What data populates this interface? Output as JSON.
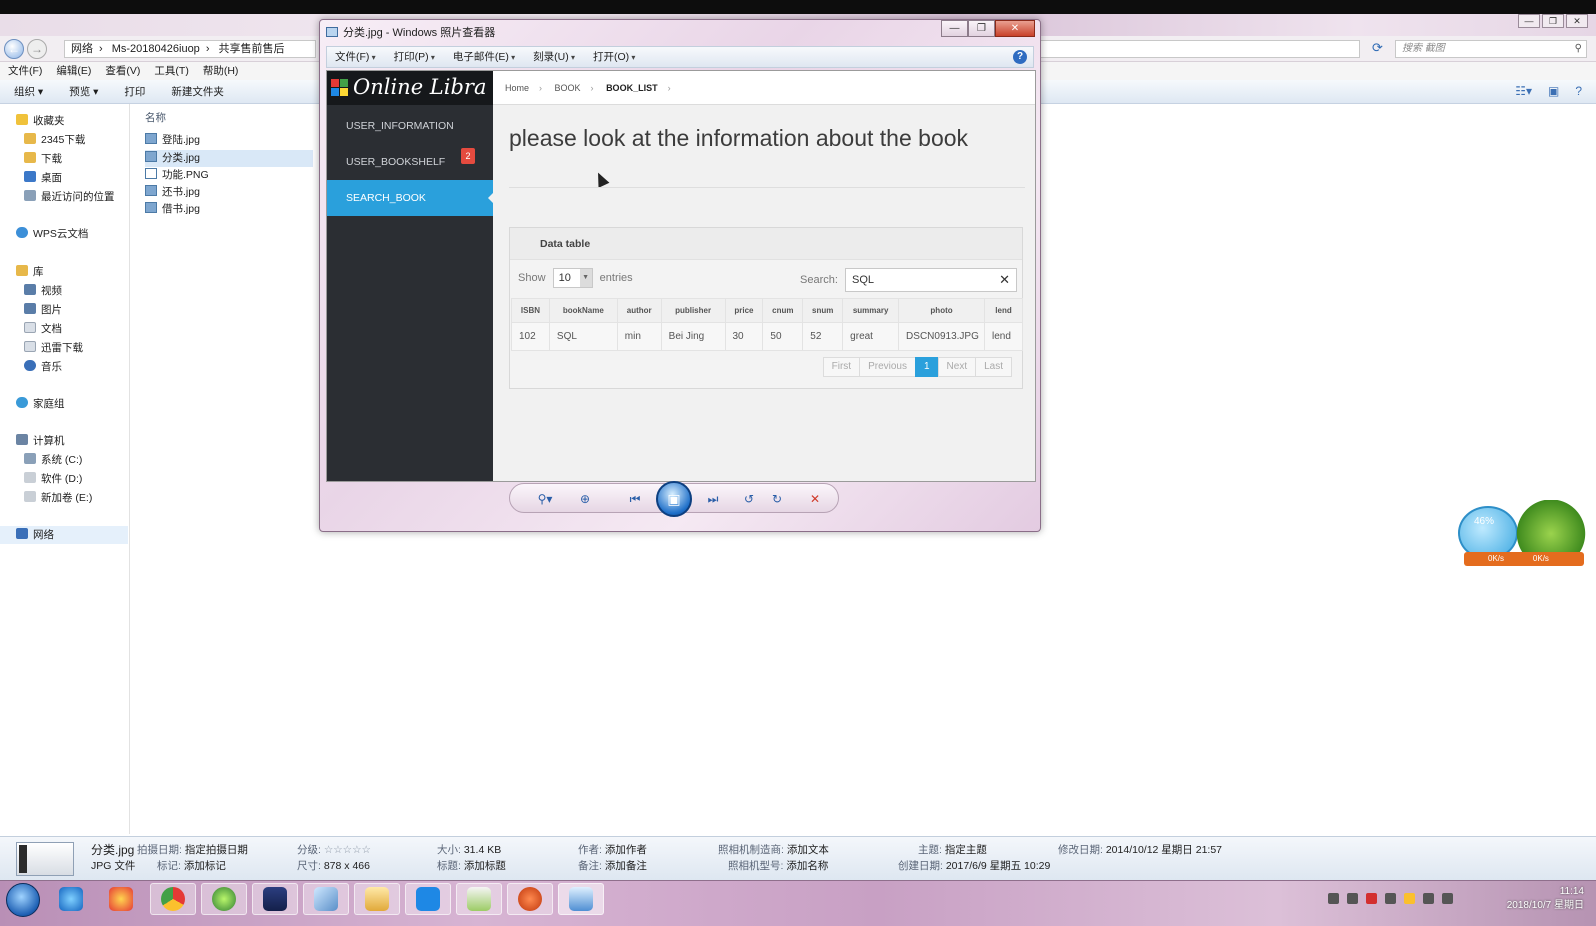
{
  "explorer": {
    "breadcrumb": [
      "网络",
      "Ms-20180426iuop",
      "共享售前售后"
    ],
    "search_placeholder": "搜索 截图",
    "menu": [
      "文件(F)",
      "编辑(E)",
      "查看(V)",
      "工具(T)",
      "帮助(H)"
    ],
    "commands": [
      "组织 ▾",
      "预览 ▾",
      "打印",
      "新建文件夹"
    ],
    "nav": [
      {
        "label": "收藏夹",
        "color": "#f0c23b"
      },
      {
        "label": "2345下载",
        "color": "#e7b84a"
      },
      {
        "label": "下载",
        "color": "#e7b84a"
      },
      {
        "label": "桌面",
        "color": "#3c78c8"
      },
      {
        "label": "最近访问的位置",
        "color": "#8aa0b8"
      },
      {
        "label": "WPS云文档",
        "color": "#3c8fd8"
      },
      {
        "label": "库",
        "color": "#e7b84a"
      },
      {
        "label": "视频",
        "color": "#5a7da8"
      },
      {
        "label": "图片",
        "color": "#5a7da8"
      },
      {
        "label": "文档",
        "color": "#d9dfe7"
      },
      {
        "label": "迅雷下载",
        "color": "#d9dfe7"
      },
      {
        "label": "音乐",
        "color": "#3a6fb8"
      },
      {
        "label": "家庭组",
        "color": "#3a9ad8"
      },
      {
        "label": "计算机",
        "color": "#6b84a3"
      },
      {
        "label": "系统 (C:)",
        "color": "#8aa0b8"
      },
      {
        "label": "软件 (D:)",
        "color": "#c9cfd6"
      },
      {
        "label": "新加卷 (E:)",
        "color": "#c9cfd6"
      },
      {
        "label": "网络",
        "color": "#3a6fb8"
      }
    ],
    "column_header": "名称",
    "files": [
      "登陆.jpg",
      "分类.jpg",
      "功能.PNG",
      "还书.jpg",
      "借书.jpg"
    ],
    "status": {
      "filename": "分类.jpg",
      "filetype": "JPG 文件",
      "k_taken": "拍摄日期:",
      "v_taken": "指定拍摄日期",
      "k_tags": "标记:",
      "v_tags": "添加标记",
      "k_rating": "分级:",
      "v_rating": "☆☆☆☆☆",
      "k_dims": "尺寸:",
      "v_dims": "878 x 466",
      "k_size": "大小:",
      "v_size": "31.4 KB",
      "k_title": "标题:",
      "v_title": "添加标题",
      "k_author": "作者:",
      "v_author": "添加作者",
      "k_comment": "备注:",
      "v_comment": "添加备注",
      "k_maker": "照相机制造商:",
      "v_maker": "添加文本",
      "k_model": "照相机型号:",
      "v_model": "添加名称",
      "k_subject": "主题:",
      "v_subject": "指定主题",
      "k_created": "创建日期:",
      "v_created": "2017/6/9 星期五 10:29",
      "k_modified": "修改日期:",
      "v_modified": "2014/10/12 星期日 21:57"
    }
  },
  "viewer": {
    "title": "分类.jpg - Windows 照片查看器",
    "menu": [
      "文件(F)",
      "打印(P)",
      "电子邮件(E)",
      "刻录(U)",
      "打开(O)"
    ],
    "app": {
      "logo": "Online Libra",
      "nav": [
        {
          "label": "USER_INFORMATION",
          "active": false
        },
        {
          "label": "USER_BOOKSHELF",
          "active": false,
          "badge": "2"
        },
        {
          "label": "SEARCH_BOOK",
          "active": true
        }
      ],
      "breadcrumb": [
        "Home",
        "BOOK",
        "BOOK_LIST"
      ],
      "heading": "please look at the information about the book",
      "panel_title": "Data table",
      "show_label": "Show",
      "entries_value": "10",
      "entries_label": "entries",
      "search_label": "Search:",
      "search_value": "SQL",
      "columns": [
        "ISBN",
        "bookName",
        "author",
        "publisher",
        "price",
        "cnum",
        "snum",
        "summary",
        "photo",
        "lend"
      ],
      "rows": [
        [
          "102",
          "SQL",
          "min",
          "Bei Jing",
          "30",
          "50",
          "52",
          "great",
          "DSCN0913.JPG",
          "lend"
        ]
      ],
      "pager": [
        "First",
        "Previous",
        "1",
        "Next",
        "Last"
      ],
      "pager_current": "1"
    }
  },
  "widget": {
    "percent": "46%",
    "speed_up": "0K/s",
    "speed_down": "0K/s"
  },
  "taskbar": {
    "time": "11:14",
    "date": "2018/10/7 星期日"
  },
  "colors": {
    "accent": "#2aa0dc",
    "badge": "#e54b3f",
    "sidebar": "#2b2e33"
  }
}
